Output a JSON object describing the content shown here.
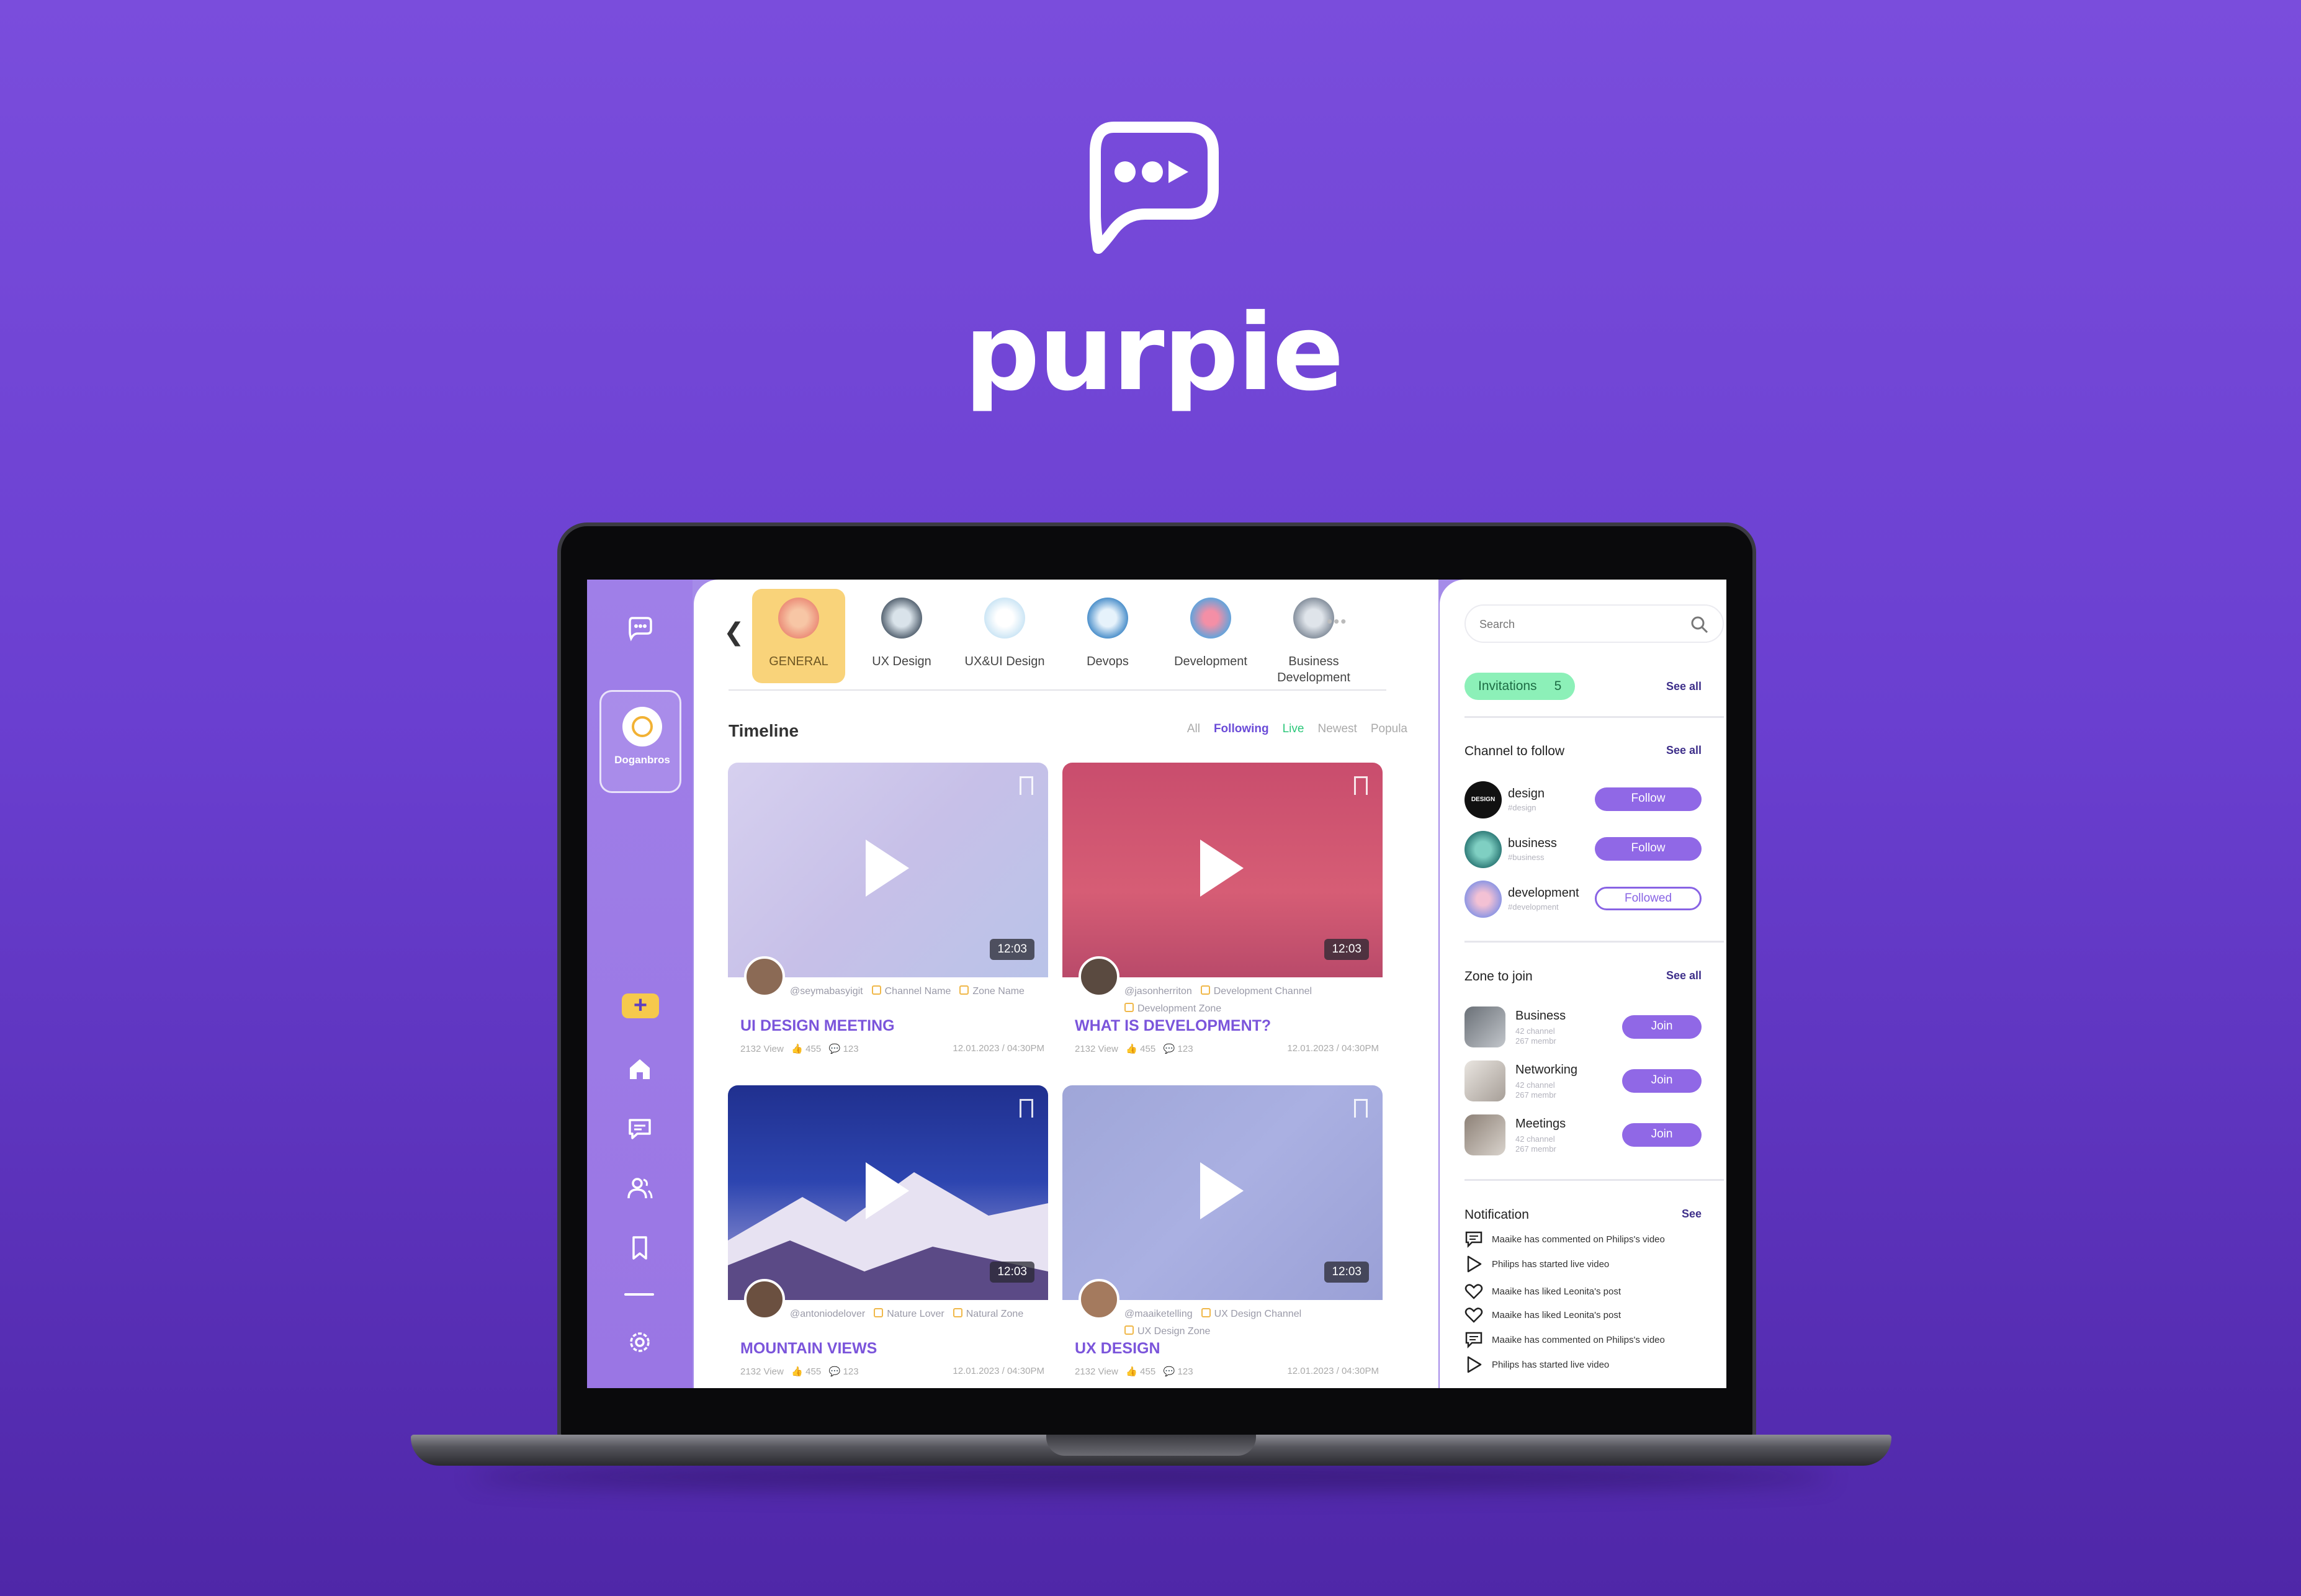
{
  "brand": {
    "name": "purpie"
  },
  "profile": {
    "name": "Doganbros"
  },
  "categories": [
    {
      "label": "GENERAL"
    },
    {
      "label": "UX Design"
    },
    {
      "label": "UX&UI Design"
    },
    {
      "label": "Devops"
    },
    {
      "label": "Development"
    },
    {
      "label": "Business Development"
    }
  ],
  "timeline": {
    "title": "Timeline",
    "filters": [
      "All",
      "Following",
      "Live",
      "Newest",
      "Popula"
    ]
  },
  "videos": [
    {
      "user": "@seymabasyigit",
      "channel": "Channel Name",
      "zone": "Zone Name",
      "title": "UI DESIGN MEETING",
      "views": "2132 View",
      "likes": "455",
      "comments": "123",
      "date": "12.01.2023 / 04:30PM",
      "duration": "12:03"
    },
    {
      "user": "@jasonherriton",
      "channel": "Development Channel",
      "zone": "Development Zone",
      "title": "WHAT IS DEVELOPMENT?",
      "views": "2132 View",
      "likes": "455",
      "comments": "123",
      "date": "12.01.2023 / 04:30PM",
      "duration": "12:03"
    },
    {
      "user": "@antoniodelover",
      "channel": "Nature Lover",
      "zone": "Natural Zone",
      "title": "MOUNTAIN VIEWS",
      "views": "2132 View",
      "likes": "455",
      "comments": "123",
      "date": "12.01.2023 / 04:30PM",
      "duration": "12:03"
    },
    {
      "user": "@maaiketelling",
      "channel": "UX Design Channel",
      "zone": "UX Design Zone",
      "title": "UX DESIGN",
      "views": "2132 View",
      "likes": "455",
      "comments": "123",
      "date": "12.01.2023 / 04:30PM",
      "duration": "12:03"
    }
  ],
  "search": {
    "placeholder": "Search"
  },
  "invitations": {
    "label": "Invitations",
    "count": "5",
    "see_all": "See all"
  },
  "channels": {
    "title": "Channel to follow",
    "see_all": "See all",
    "items": [
      {
        "name": "design",
        "tag": "#design",
        "action": "Follow",
        "avatar_text": "DESIGN"
      },
      {
        "name": "business",
        "tag": "#business",
        "action": "Follow"
      },
      {
        "name": "development",
        "tag": "#development",
        "action": "Followed"
      }
    ]
  },
  "zones": {
    "title": "Zone to join",
    "see_all": "See all",
    "items": [
      {
        "name": "Business",
        "channels": "42 channel",
        "members": "267 membr",
        "action": "Join"
      },
      {
        "name": "Networking",
        "channels": "42 channel",
        "members": "267 membr",
        "action": "Join"
      },
      {
        "name": "Meetings",
        "channels": "42 channel",
        "members": "267 membr",
        "action": "Join"
      }
    ]
  },
  "notifications": {
    "title": "Notification",
    "see": "See",
    "items": [
      {
        "icon": "comment-icon",
        "text": "Maaike has commented on Philips's video"
      },
      {
        "icon": "play-icon",
        "text": "Philips has started live video"
      },
      {
        "icon": "heart-icon",
        "text": "Maaike has liked Leonita's post"
      },
      {
        "icon": "heart-icon",
        "text": "Maaike has liked Leonita's post"
      },
      {
        "icon": "comment-icon",
        "text": "Maaike has commented on Philips's video"
      },
      {
        "icon": "play-icon",
        "text": "Philips has started live video"
      }
    ]
  },
  "colors": {
    "brand": "#6a3fd0",
    "accent": "#9068e6",
    "live": "#2cc77a",
    "general": "#f9d37a"
  }
}
